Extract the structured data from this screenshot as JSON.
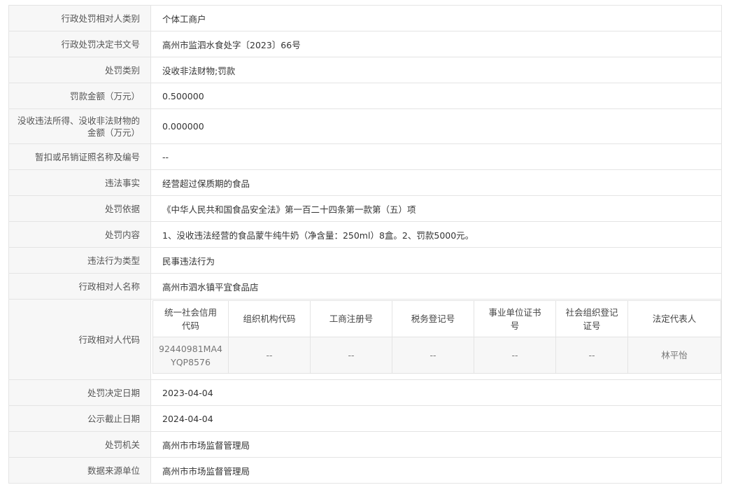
{
  "rows": [
    {
      "label": "行政处罚相对人类别",
      "value": "个体工商户"
    },
    {
      "label": "行政处罚决定书文号",
      "value": "高州市监泗水食处字〔2023〕66号"
    },
    {
      "label": "处罚类别",
      "value": "没收非法财物;罚款"
    },
    {
      "label": "罚款金额（万元）",
      "value": "0.500000"
    },
    {
      "label_line1": "没收违法所得、没收非法财物的",
      "label_line2": "金额（万元）",
      "value": "0.000000"
    },
    {
      "label": "暂扣或吊销证照名称及编号",
      "value": "--"
    },
    {
      "label": "违法事实",
      "value": "经营超过保质期的食品"
    },
    {
      "label": "处罚依据",
      "value": "《中华人民共和国食品安全法》第一百二十四条第一款第（五）项"
    },
    {
      "label": "处罚内容",
      "value": "1、没收违法经营的食品蒙牛纯牛奶（净含量：250ml）8盒。2、罚款5000元。"
    },
    {
      "label": "违法行为类型",
      "value": "民事违法行为"
    },
    {
      "label": "行政相对人名称",
      "value": "高州市泗水镇平宜食品店"
    }
  ],
  "code": {
    "label": "行政相对人代码",
    "headers": [
      {
        "l1": "统一社会信用",
        "l2": "代码"
      },
      {
        "l1": "组织机构代码",
        "l2": ""
      },
      {
        "l1": "工商注册号",
        "l2": ""
      },
      {
        "l1": "税务登记号",
        "l2": ""
      },
      {
        "l1": "事业单位证书",
        "l2": "号"
      },
      {
        "l1": "社会组织登记",
        "l2": "证号"
      },
      {
        "l1": "法定代表人",
        "l2": ""
      }
    ],
    "values": [
      {
        "l1": "92440981MA4",
        "l2": "YQP8576"
      },
      {
        "l1": "--",
        "l2": ""
      },
      {
        "l1": "--",
        "l2": ""
      },
      {
        "l1": "--",
        "l2": ""
      },
      {
        "l1": "--",
        "l2": ""
      },
      {
        "l1": "--",
        "l2": ""
      },
      {
        "l1": "林平怡",
        "l2": ""
      }
    ]
  },
  "rows_after": [
    {
      "label": "处罚决定日期",
      "value": "2023-04-04"
    },
    {
      "label": "公示截止日期",
      "value": "2024-04-04"
    },
    {
      "label": "处罚机关",
      "value": "高州市市场监督管理局"
    },
    {
      "label": "数据来源单位",
      "value": "高州市市场监督管理局"
    }
  ]
}
